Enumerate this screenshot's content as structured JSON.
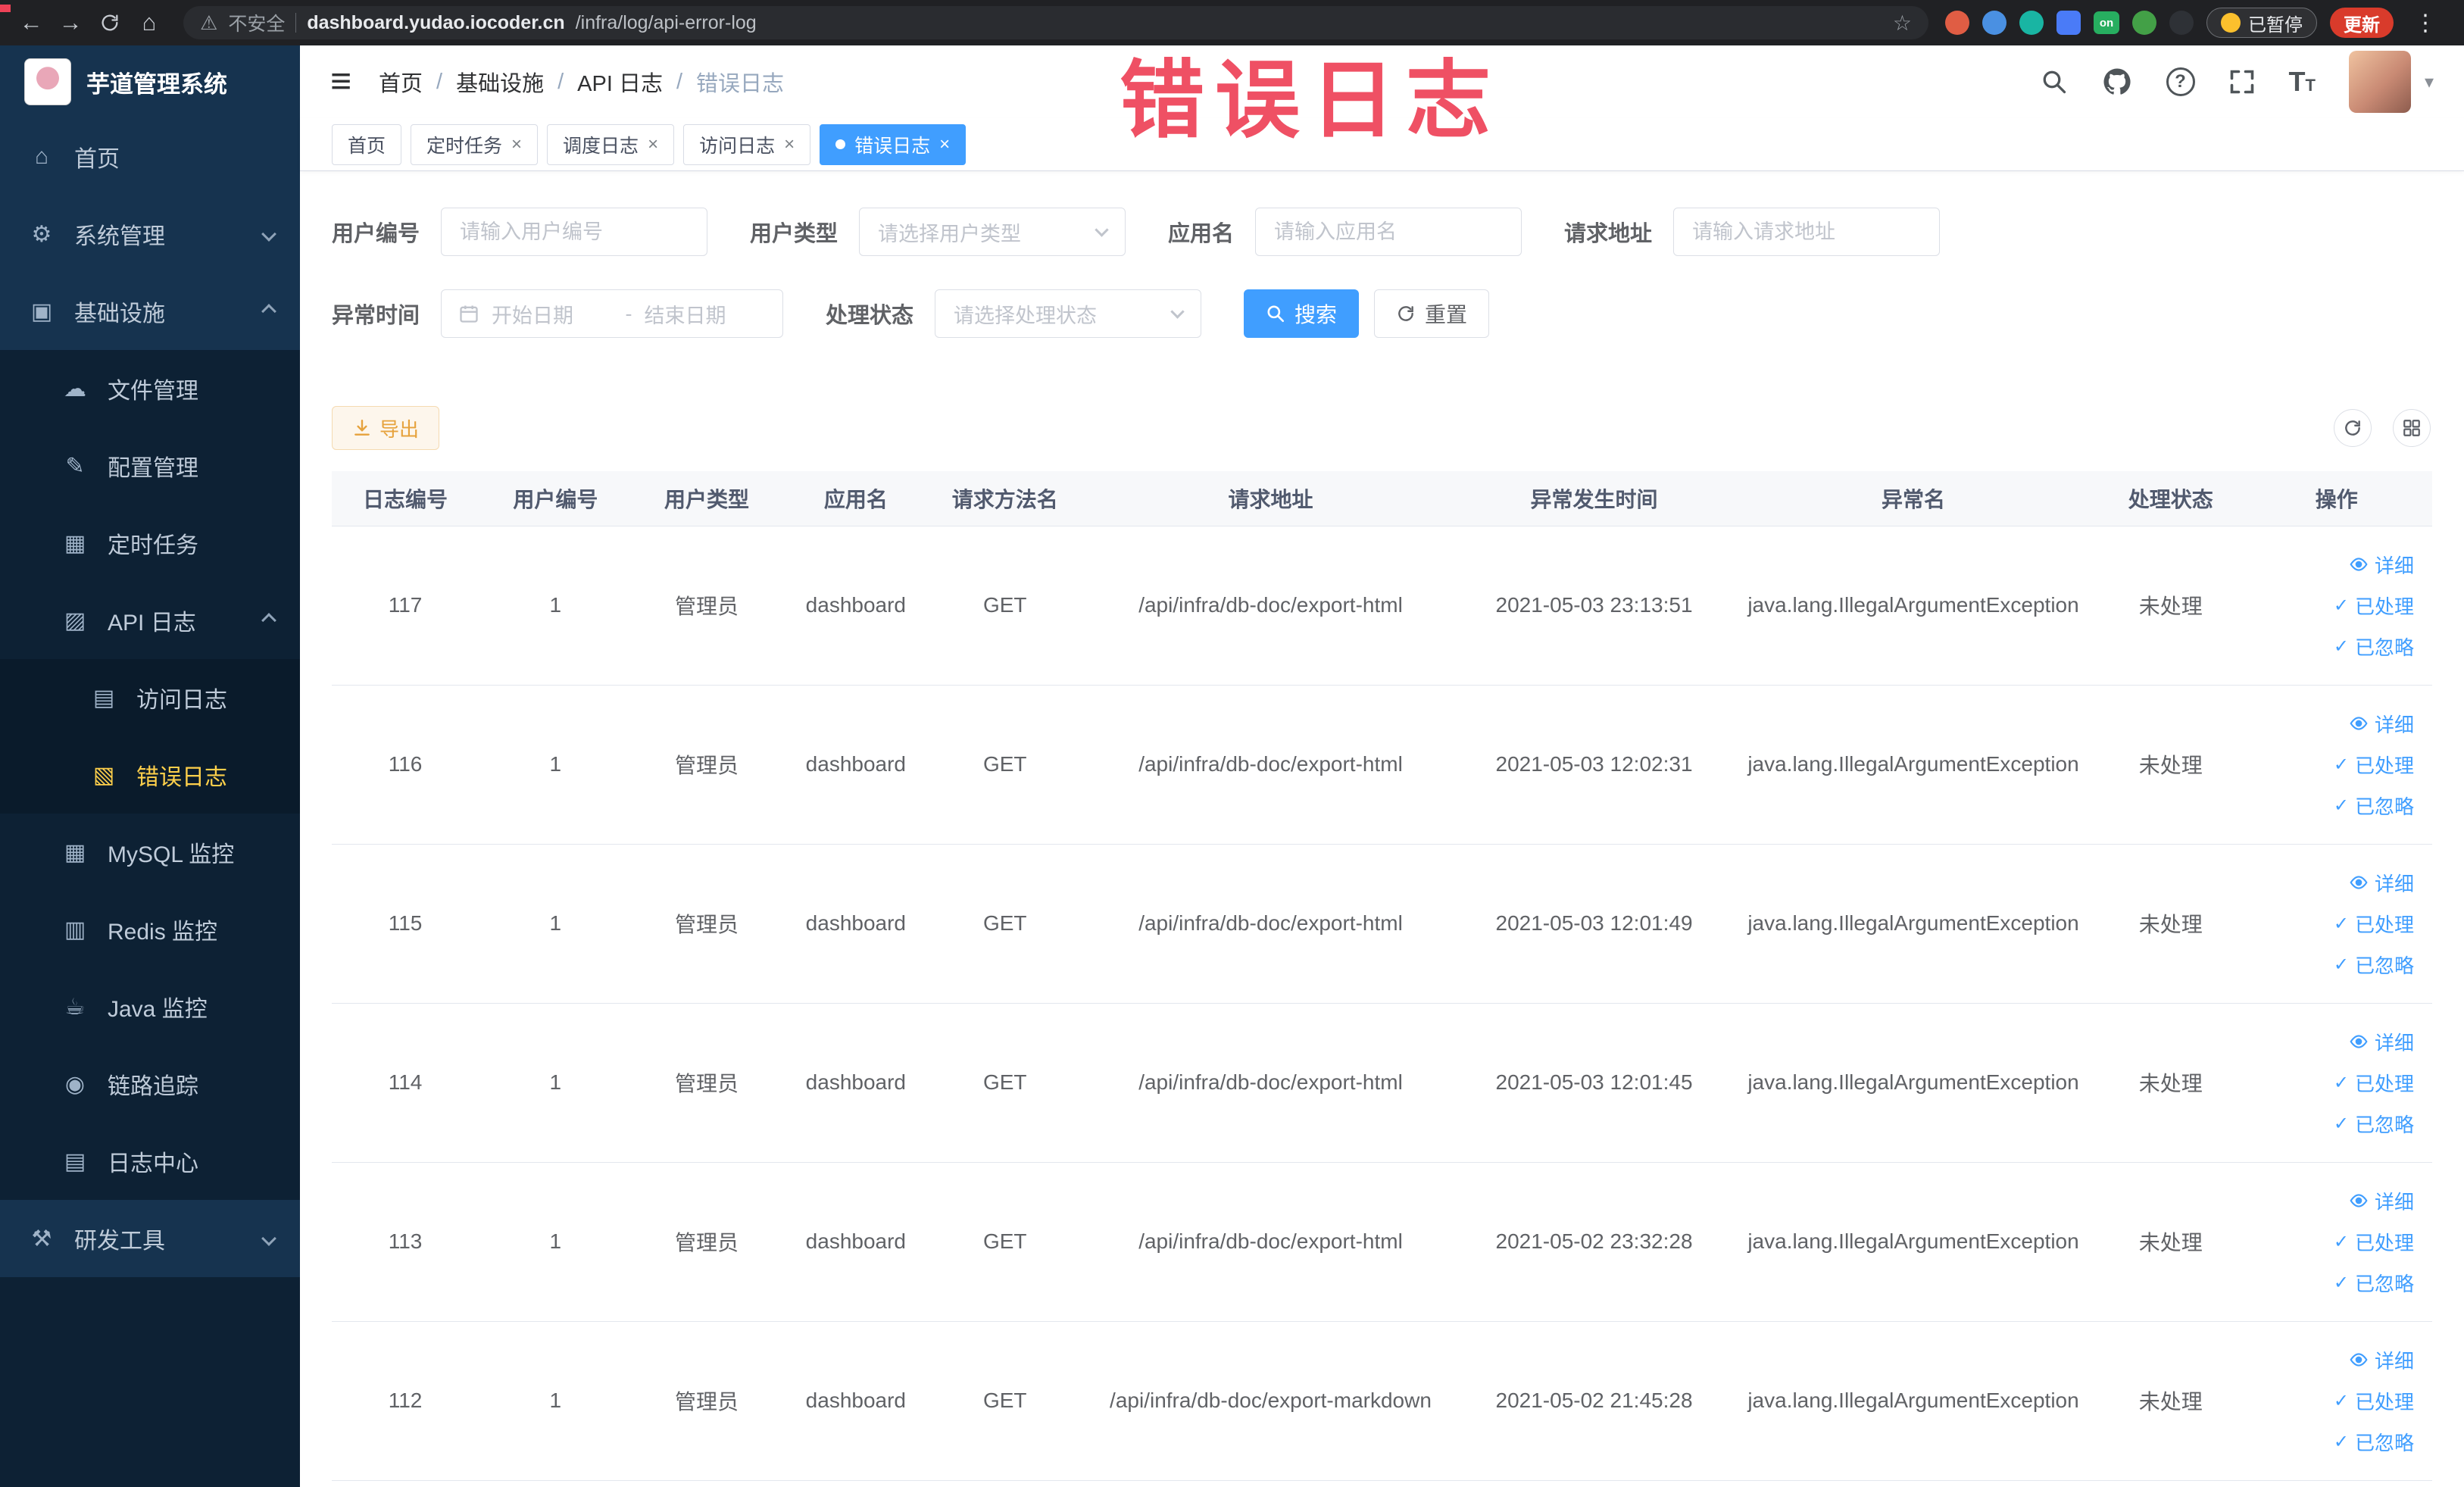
{
  "browser": {
    "security_label": "不安全",
    "url_domain": "dashboard.yudao.iocoder.cn",
    "url_path": "/infra/log/api-error-log",
    "ext_on_badge": "on",
    "paused_label": "已暂停",
    "update_label": "更新"
  },
  "sidebar": {
    "logo_title": "芋道管理系统",
    "items": [
      {
        "label": "首页",
        "level": 1,
        "icon": "home-icon"
      },
      {
        "label": "系统管理",
        "level": 1,
        "icon": "gear-icon",
        "arrow": "down"
      },
      {
        "label": "基础设施",
        "level": 1,
        "icon": "infrastructure-icon",
        "arrow": "up"
      },
      {
        "label": "文件管理",
        "level": 2,
        "icon": "file-manage-icon"
      },
      {
        "label": "配置管理",
        "level": 2,
        "icon": "config-manage-icon"
      },
      {
        "label": "定时任务",
        "level": 2,
        "icon": "scheduled-job-icon"
      },
      {
        "label": "API 日志",
        "level": 2,
        "icon": "api-log-icon",
        "arrow": "up"
      },
      {
        "label": "访问日志",
        "level": 3,
        "icon": "access-log-icon"
      },
      {
        "label": "错误日志",
        "level": 3,
        "icon": "error-log-icon",
        "active": true
      },
      {
        "label": "MySQL 监控",
        "level": 2,
        "icon": "mysql-monitor-icon"
      },
      {
        "label": "Redis 监控",
        "level": 2,
        "icon": "redis-monitor-icon"
      },
      {
        "label": "Java 监控",
        "level": 2,
        "icon": "java-monitor-icon"
      },
      {
        "label": "链路追踪",
        "level": 2,
        "icon": "trace-icon"
      },
      {
        "label": "日志中心",
        "level": 2,
        "icon": "log-center-icon"
      },
      {
        "label": "研发工具",
        "level": 1,
        "icon": "dev-tools-icon",
        "arrow": "down"
      }
    ]
  },
  "header": {
    "breadcrumb": [
      "首页",
      "基础设施",
      "API 日志",
      "错误日志"
    ],
    "separator": "/"
  },
  "overlay": {
    "text": "错误日志"
  },
  "tabs": [
    {
      "label": "首页",
      "closable": false,
      "active": false
    },
    {
      "label": "定时任务",
      "closable": true,
      "active": false
    },
    {
      "label": "调度日志",
      "closable": true,
      "active": false
    },
    {
      "label": "访问日志",
      "closable": true,
      "active": false
    },
    {
      "label": "错误日志",
      "closable": true,
      "active": true
    }
  ],
  "filters": {
    "user_id": {
      "label": "用户编号",
      "placeholder": "请输入用户编号"
    },
    "user_type": {
      "label": "用户类型",
      "placeholder": "请选择用户类型"
    },
    "app_name": {
      "label": "应用名",
      "placeholder": "请输入应用名"
    },
    "request_url": {
      "label": "请求地址",
      "placeholder": "请输入请求地址"
    },
    "exception_time": {
      "label": "异常时间",
      "start_placeholder": "开始日期",
      "separator": "-",
      "end_placeholder": "结束日期"
    },
    "process_status": {
      "label": "处理状态",
      "placeholder": "请选择处理状态"
    },
    "search_label": "搜索",
    "reset_label": "重置"
  },
  "toolbar": {
    "export_label": "导出"
  },
  "table": {
    "columns": [
      "日志编号",
      "用户编号",
      "用户类型",
      "应用名",
      "请求方法名",
      "请求地址",
      "异常发生时间",
      "异常名",
      "处理状态",
      "操作"
    ],
    "rows": [
      {
        "id": "117",
        "user_id": "1",
        "user_type": "管理员",
        "app": "dashboard",
        "method": "GET",
        "url": "/api/infra/db-doc/export-html",
        "time": "2021-05-03 23:13:51",
        "exception": "java.lang.IllegalArgumentException",
        "status": "未处理"
      },
      {
        "id": "116",
        "user_id": "1",
        "user_type": "管理员",
        "app": "dashboard",
        "method": "GET",
        "url": "/api/infra/db-doc/export-html",
        "time": "2021-05-03 12:02:31",
        "exception": "java.lang.IllegalArgumentException",
        "status": "未处理"
      },
      {
        "id": "115",
        "user_id": "1",
        "user_type": "管理员",
        "app": "dashboard",
        "method": "GET",
        "url": "/api/infra/db-doc/export-html",
        "time": "2021-05-03 12:01:49",
        "exception": "java.lang.IllegalArgumentException",
        "status": "未处理"
      },
      {
        "id": "114",
        "user_id": "1",
        "user_type": "管理员",
        "app": "dashboard",
        "method": "GET",
        "url": "/api/infra/db-doc/export-html",
        "time": "2021-05-03 12:01:45",
        "exception": "java.lang.IllegalArgumentException",
        "status": "未处理"
      },
      {
        "id": "113",
        "user_id": "1",
        "user_type": "管理员",
        "app": "dashboard",
        "method": "GET",
        "url": "/api/infra/db-doc/export-html",
        "time": "2021-05-02 23:32:28",
        "exception": "java.lang.IllegalArgumentException",
        "status": "未处理"
      },
      {
        "id": "112",
        "user_id": "1",
        "user_type": "管理员",
        "app": "dashboard",
        "method": "GET",
        "url": "/api/infra/db-doc/export-markdown",
        "time": "2021-05-02 21:45:28",
        "exception": "java.lang.IllegalArgumentException",
        "status": "未处理"
      }
    ],
    "row_actions": {
      "detail": "详细",
      "processed": "已处理",
      "ignored": "已忽略"
    }
  },
  "colors": {
    "primary": "#409eff",
    "menu_active": "#ffd04b",
    "warning": "#e6a23c",
    "overlay_red": "#ee4257",
    "update_red": "#d93b2b"
  }
}
